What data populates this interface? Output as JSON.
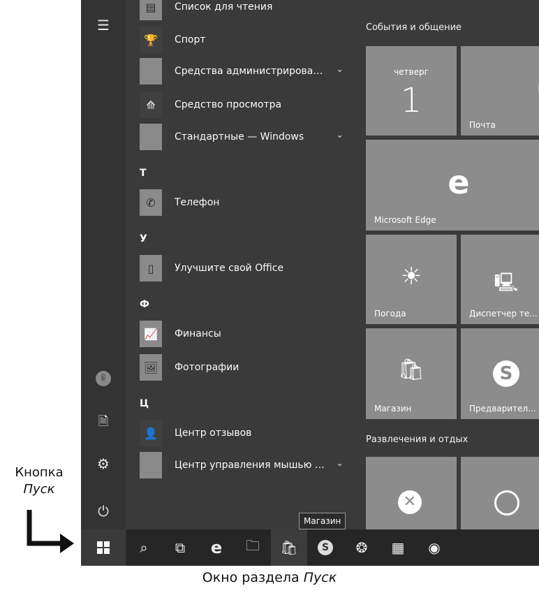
{
  "app_list": {
    "items": [
      {
        "label": "Список для чтения",
        "icon": "reading-list-icon",
        "glyph": "▤",
        "chevron": false
      },
      {
        "label": "Спорт",
        "icon": "trophy-icon",
        "glyph": "🏆",
        "chevron": false
      },
      {
        "label": "Средства администрировани...",
        "icon": "folder-icon",
        "glyph": "",
        "chevron": true
      },
      {
        "label": "Средство просмотра",
        "icon": "viewer-icon",
        "glyph": "⟰",
        "chevron": false
      },
      {
        "label": "Стандартные — Windows",
        "icon": "folder-icon",
        "glyph": "",
        "chevron": true
      },
      {
        "letter": "Т"
      },
      {
        "label": "Телефон",
        "icon": "phone-icon",
        "glyph": "✆",
        "chevron": false
      },
      {
        "letter": "У"
      },
      {
        "label": "Улучшите свой Office",
        "icon": "office-icon",
        "glyph": "▯",
        "chevron": false
      },
      {
        "letter": "Ф"
      },
      {
        "label": "Финансы",
        "icon": "finance-chart-icon",
        "glyph": "📈",
        "chevron": false
      },
      {
        "label": "Фотографии",
        "icon": "photo-icon",
        "glyph": "🖼",
        "chevron": false
      },
      {
        "letter": "Ц"
      },
      {
        "label": "Центр отзывов",
        "icon": "feedback-icon",
        "glyph": "👤",
        "chevron": false
      },
      {
        "label": "Центр управления мышью и...",
        "icon": "folder-icon",
        "glyph": "",
        "chevron": true
      }
    ]
  },
  "tiles": {
    "group1_title": "События и общение",
    "calendar": {
      "day_name": "четверг",
      "day_number": "1"
    },
    "mail": {
      "label": "Почта"
    },
    "edge": {
      "label": "Microsoft Edge"
    },
    "weather": {
      "label": "Погода"
    },
    "devices": {
      "label": "Диспетчер те..."
    },
    "store": {
      "label": "Магазин"
    },
    "skype": {
      "label": "Предварител..."
    },
    "group2_title": "Развлечения и отдых"
  },
  "taskbar": {
    "tooltip": "Магазин"
  },
  "annotations": {
    "start_label_line1": "Кнопка",
    "start_label_line2": "Пуск",
    "caption_prefix": "Окно раздела ",
    "caption_italic": "Пуск"
  },
  "colors": {
    "screen_bg": "#3a3a3a",
    "tile_bg": "#8c8c8c",
    "taskbar_bg": "#262626"
  }
}
